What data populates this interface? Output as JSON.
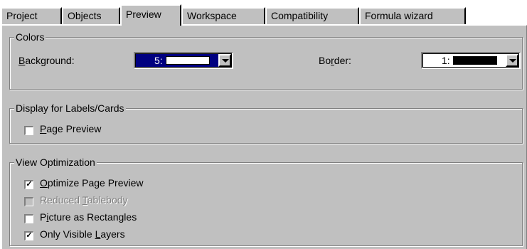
{
  "tabs": [
    {
      "label": "Project"
    },
    {
      "label": "Objects"
    },
    {
      "label": "Preview"
    },
    {
      "label": "Workspace"
    },
    {
      "label": "Compatibility"
    },
    {
      "label": "Formula wizard"
    }
  ],
  "colors": {
    "group_label": "Colors",
    "background_label": "Background:",
    "background_value": "5:",
    "background_swatch": "#ffffff",
    "border_label": "Border:",
    "border_value": "1:",
    "border_swatch": "#000000"
  },
  "display": {
    "group_label": "Display for Labels/Cards",
    "page_preview": {
      "label": "Page Preview",
      "checked": false
    }
  },
  "view": {
    "group_label": "View Optimization",
    "items": [
      {
        "label": "Optimize Page Preview",
        "checked": true,
        "enabled": true
      },
      {
        "label": "Reduced Tablebody",
        "checked": false,
        "enabled": false
      },
      {
        "label": "Picture as Rectangles",
        "checked": false,
        "enabled": true
      },
      {
        "label": "Only Visible Layers",
        "checked": true,
        "enabled": true
      }
    ]
  },
  "theme": {
    "face": "#c0c0c0",
    "highlight": "#000080",
    "shadow": "#808080"
  }
}
